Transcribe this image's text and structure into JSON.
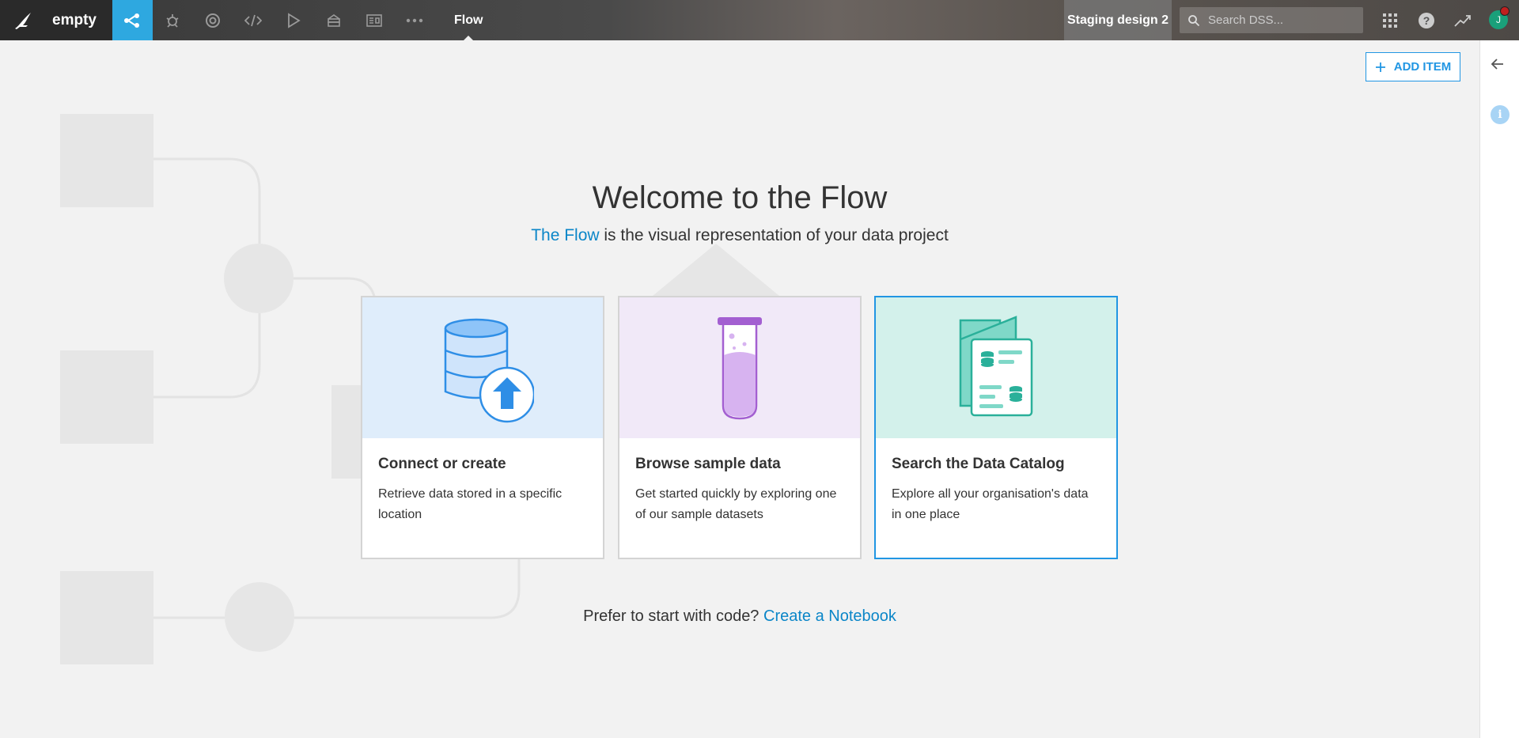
{
  "topbar": {
    "project_name": "empty",
    "current_view": "Flow",
    "instance_name": "Staging design 2",
    "search_placeholder": "Search DSS...",
    "avatar_initial": "J",
    "nav_icons": [
      "flow-icon",
      "recipes-icon",
      "lifecycle-icon",
      "code-icon",
      "run-icon",
      "dashboards-icon",
      "wiki-icon",
      "more-icon"
    ]
  },
  "add_item": {
    "label": "ADD ITEM"
  },
  "welcome": {
    "title": "Welcome to the Flow",
    "subtitle_link": "The Flow",
    "subtitle_rest": " is the visual representation of your data project"
  },
  "cards": [
    {
      "title": "Connect or create",
      "description": "Retrieve data stored in a specific location"
    },
    {
      "title": "Browse sample data",
      "description": "Get started quickly by exploring one of our sample datasets"
    },
    {
      "title": "Search the Data Catalog",
      "description": "Explore all your organisation's data in one place"
    }
  ],
  "notebook": {
    "prompt": "Prefer to start with code? ",
    "link": "Create a Notebook"
  },
  "colors": {
    "accent": "#2196e3",
    "active_nav": "#2ea8e0",
    "link": "#0b86c8"
  }
}
